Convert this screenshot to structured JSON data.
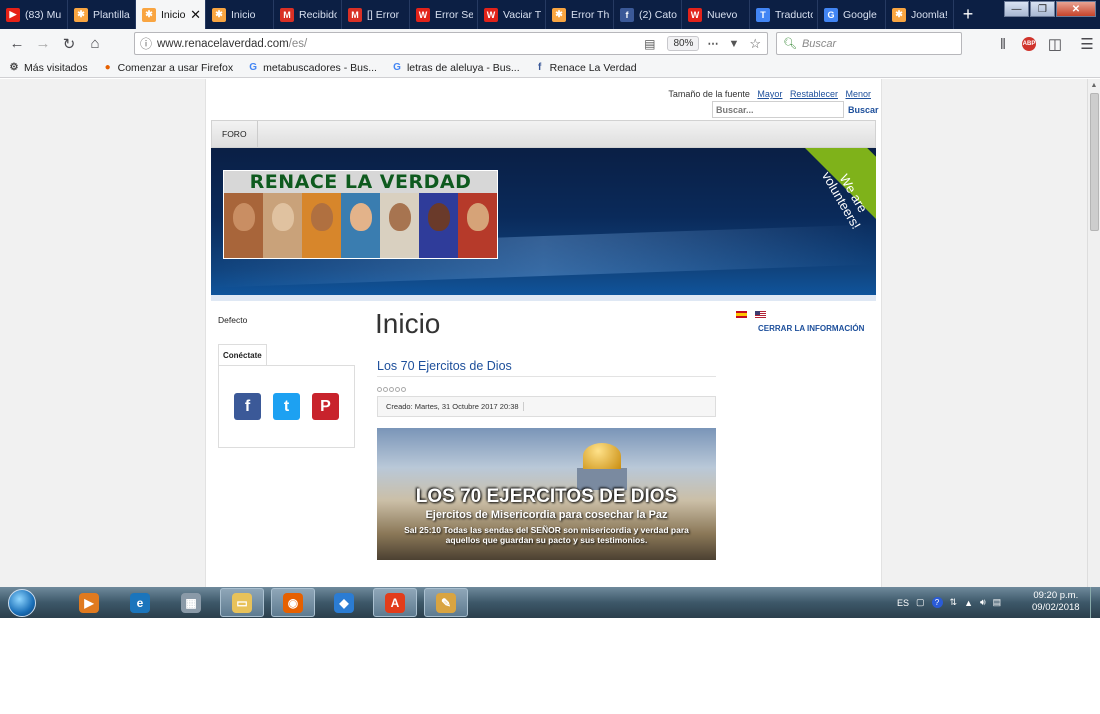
{
  "browser": {
    "tabs": [
      {
        "title": "(83) Mu",
        "icon": "youtube-icon",
        "color": "#e62117"
      },
      {
        "title": "Plantilla",
        "icon": "joomla-icon",
        "color": "#f9a541"
      },
      {
        "title": "Inicio",
        "icon": "joomla-icon",
        "color": "#f9a541",
        "active": true
      },
      {
        "title": "Inicio",
        "icon": "joomla-icon",
        "color": "#f9a541"
      },
      {
        "title": "Recibido",
        "icon": "gmail-icon",
        "color": "#d93025"
      },
      {
        "title": "[] Error",
        "icon": "gmail-icon",
        "color": "#d93025"
      },
      {
        "title": "Error Se",
        "icon": "wuf-icon",
        "color": "#e2231a"
      },
      {
        "title": "Vaciar T",
        "icon": "wuf-icon",
        "color": "#e2231a"
      },
      {
        "title": "Error Th",
        "icon": "joomla-icon",
        "color": "#f9a541"
      },
      {
        "title": "(2) Cato",
        "icon": "facebook-icon",
        "color": "#3b5998"
      },
      {
        "title": "Nuevo",
        "icon": "wuf-icon",
        "color": "#e2231a"
      },
      {
        "title": "Traducto",
        "icon": "translate-icon",
        "color": "#4285f4"
      },
      {
        "title": "Google",
        "icon": "google-icon",
        "color": "#4285f4"
      },
      {
        "title": "Joomla!",
        "icon": "joomla-icon",
        "color": "#f9a541"
      }
    ],
    "url_main": "www.renacelaverdad.com",
    "url_path": "/es/",
    "zoom": "80%",
    "search_placeholder": "Buscar",
    "bookmarks": [
      {
        "label": "Más visitados",
        "icon": "gear-icon"
      },
      {
        "label": "Comenzar a usar Firefox",
        "icon": "firefox-icon"
      },
      {
        "label": "metabuscadores - Bus...",
        "icon": "google-icon"
      },
      {
        "label": "letras de aleluya - Bus...",
        "icon": "google-icon"
      },
      {
        "label": "Renace La Verdad",
        "icon": "facebook-icon"
      }
    ]
  },
  "site": {
    "font_size_label": "Tamaño de la fuente",
    "font_size_bigger": "Mayor",
    "font_size_reset": "Restablecer",
    "font_size_smaller": "Menor",
    "search_placeholder": "Buscar...",
    "search_button": "Buscar",
    "menu": [
      "FORO"
    ],
    "logo_title": "RENACE LA VERDAD",
    "ribbon_text": "We are volunteers!",
    "sidebar_default": "Defecto",
    "connect_tab": "Conéctate",
    "social": [
      {
        "name": "facebook",
        "glyph": "f",
        "color": "#3b5998"
      },
      {
        "name": "twitter",
        "glyph": "t",
        "color": "#1da1f2"
      },
      {
        "name": "pinterest",
        "glyph": "P",
        "color": "#c8232c"
      }
    ],
    "page_title": "Inicio",
    "article_title": "Los 70 Ejercitos de Dios",
    "article_meta": "Creado: Martes, 31 Octubre 2017 20:38",
    "image_title": "LOS 70 EJERCITOS DE DIOS",
    "image_subtitle": "Ejercitos de Misericordia para cosechar la Paz",
    "image_quote": "Sal 25:10  Todas las sendas del SEÑOR son misericordia y verdad para aquellos que guardan su pacto y sus testimonios.",
    "close_info": "CERRAR LA INFORMACIÓN"
  },
  "taskbar": {
    "language": "ES",
    "time": "09:20 p.m.",
    "date": "09/02/2018",
    "apps": [
      {
        "name": "media-player-icon",
        "glyph": "▶",
        "color": "#e07a1f"
      },
      {
        "name": "internet-explorer-icon",
        "glyph": "e",
        "color": "#1b75bc"
      },
      {
        "name": "calculator-icon",
        "glyph": "▦",
        "color": "#8a9aa8"
      },
      {
        "name": "file-explorer-icon",
        "glyph": "▭",
        "color": "#e8c25a",
        "pinned": true
      },
      {
        "name": "firefox-icon",
        "glyph": "◉",
        "color": "#e66000",
        "pinned": true
      },
      {
        "name": "settings-app-icon",
        "glyph": "◆",
        "color": "#2b7cd3"
      },
      {
        "name": "pdf-app-icon",
        "glyph": "A",
        "color": "#e23c1b",
        "pinned": true
      },
      {
        "name": "paint-icon",
        "glyph": "✎",
        "color": "#d9a441",
        "pinned": true
      }
    ]
  }
}
